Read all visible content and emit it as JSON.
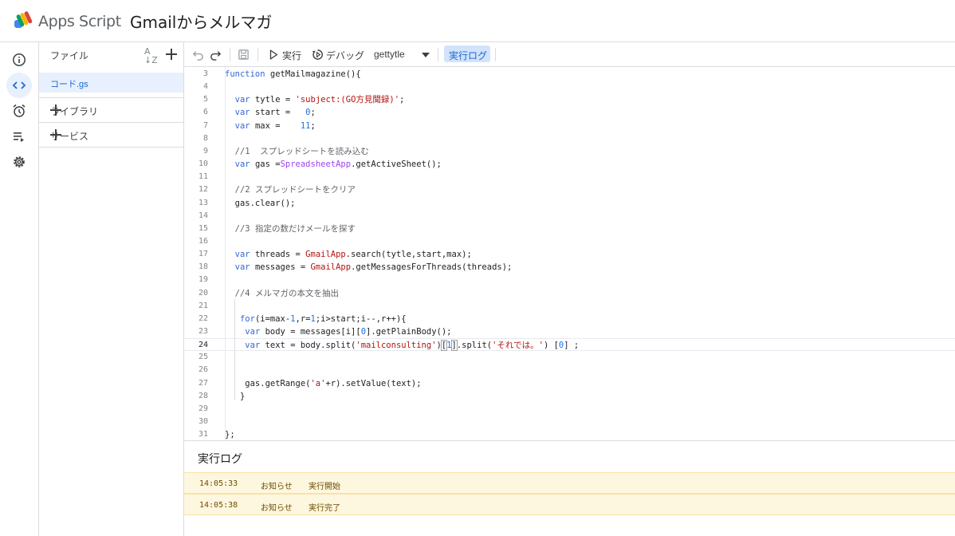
{
  "header": {
    "app_name": "Apps Script",
    "project_title": "Gmailからメルマガ"
  },
  "rail": {
    "items": [
      {
        "name": "overview",
        "icon": "info-icon"
      },
      {
        "name": "editor",
        "icon": "code-icon",
        "active": true
      },
      {
        "name": "triggers",
        "icon": "alarm-clock-icon"
      },
      {
        "name": "executions",
        "icon": "executions-list-icon"
      },
      {
        "name": "settings",
        "icon": "gear-icon"
      }
    ]
  },
  "files": {
    "title": "ファイル",
    "sort_label": "AZ",
    "items": [
      {
        "label": "コード.gs"
      }
    ],
    "libraries_label": "ライブラリ",
    "services_label": "サービス"
  },
  "toolbar": {
    "run_label": "実行",
    "debug_label": "デバッグ",
    "function_name": "gettytle",
    "log_label": "実行ログ"
  },
  "editor": {
    "current_line": 24,
    "lines": [
      {
        "n": "3",
        "html": "<span class=\"kw\">function</span> getMailmagazine(){"
      },
      {
        "n": "4",
        "html": ""
      },
      {
        "n": "5",
        "html": "  <span class=\"kw\">var</span> tytle = <span class=\"str\">'subject:(GO方見聞録)'</span>;"
      },
      {
        "n": "6",
        "html": "  <span class=\"kw\">var</span> start =   <span class=\"num\">0</span>;"
      },
      {
        "n": "7",
        "html": "  <span class=\"kw\">var</span> max =    <span class=\"num\">11</span>;"
      },
      {
        "n": "8",
        "html": ""
      },
      {
        "n": "9",
        "html": "  <span class=\"cm\">//1  スプレッドシートを読み込む</span>"
      },
      {
        "n": "10",
        "html": "  <span class=\"kw\">var</span> gas =<span class=\"cls\">SpreadsheetApp</span>.getActiveSheet();"
      },
      {
        "n": "11",
        "html": ""
      },
      {
        "n": "12",
        "html": "  <span class=\"cm\">//2 スプレッドシートをクリア</span>"
      },
      {
        "n": "13",
        "html": "  gas.clear();"
      },
      {
        "n": "14",
        "html": ""
      },
      {
        "n": "15",
        "html": "  <span class=\"cm\">//3 指定の数だけメールを探す</span>"
      },
      {
        "n": "16",
        "html": ""
      },
      {
        "n": "17",
        "html": "  <span class=\"kw\">var</span> threads = <span class=\"str\">GmailApp</span>.search(tytle,start,max);"
      },
      {
        "n": "18",
        "html": "  <span class=\"kw\">var</span> messages = <span class=\"str\">GmailApp</span>.getMessagesForThreads(threads);"
      },
      {
        "n": "19",
        "html": ""
      },
      {
        "n": "20",
        "html": "  <span class=\"cm\">//4 メルマガの本文を抽出</span>"
      },
      {
        "n": "21",
        "html": ""
      },
      {
        "n": "22",
        "html": "   <span class=\"kw\">for</span>(i=max-<span class=\"num\">1</span>,r=<span class=\"num\">1</span>;i&gt;start;i--,r++){"
      },
      {
        "n": "23",
        "html": "    <span class=\"kw\">var</span> body = messages[i][<span class=\"num\">0</span>].getPlainBody();"
      },
      {
        "n": "24",
        "html": "    <span class=\"kw\">var</span> text = body.split(<span class=\"str\">'mailconsulting'</span>)<span class=\"bracket-box\">[</span><span class=\"num\">1</span><span class=\"bracket-box\">]</span>.split(<span class=\"str\">'それでは。'</span>) [<span class=\"num\">0</span>] ;"
      },
      {
        "n": "25",
        "html": ""
      },
      {
        "n": "26",
        "html": ""
      },
      {
        "n": "27",
        "html": "    gas.getRange(<span class=\"str\">'a'</span>+r).setValue(text);"
      },
      {
        "n": "28",
        "html": "   }"
      },
      {
        "n": "29",
        "html": ""
      },
      {
        "n": "30",
        "html": ""
      },
      {
        "n": "31",
        "html": "};"
      }
    ]
  },
  "log": {
    "title": "実行ログ",
    "rows": [
      {
        "time": "14:05:33",
        "level": "お知らせ",
        "message": "実行開始"
      },
      {
        "time": "14:05:38",
        "level": "お知らせ",
        "message": "実行完了"
      }
    ]
  },
  "colors": {
    "accent": "#1967d2",
    "active_bg": "#e8f0fe",
    "log_row_bg": "#fef7e0"
  }
}
